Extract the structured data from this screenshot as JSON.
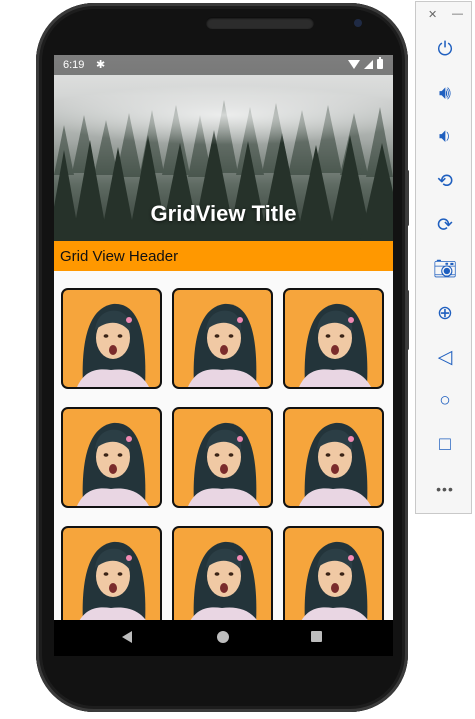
{
  "statusbar": {
    "time": "6:19"
  },
  "app": {
    "title": "GridView Title",
    "grid_header": "Grid View Header",
    "grid_items": [
      "girl-photo",
      "girl-photo",
      "girl-photo",
      "girl-photo",
      "girl-photo",
      "girl-photo",
      "girl-photo",
      "girl-photo",
      "girl-photo"
    ]
  },
  "toolbar": {
    "close": "✕",
    "minimize": "—",
    "more": "•••"
  },
  "colors": {
    "accent": "#ff9800",
    "tile_bg": "#f6a53c",
    "toolbar_icon": "#1f5fbf"
  }
}
